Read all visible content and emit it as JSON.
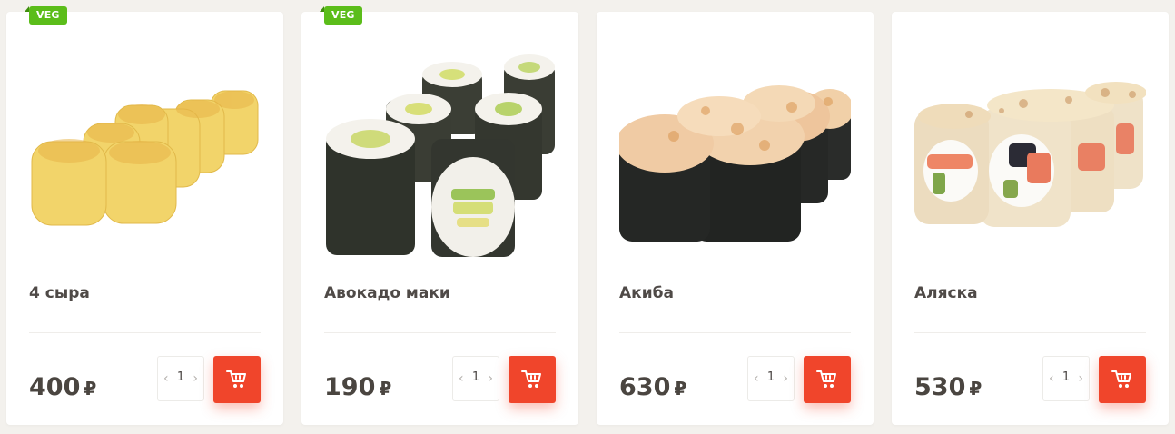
{
  "theme": {
    "accent": "#f0452b",
    "veg_badge": "#5bbd1a",
    "background": "#f3f1ed"
  },
  "products": [
    {
      "name": "4 сыра",
      "price": "400",
      "currency": "₽",
      "qty": "1",
      "badge": "VEG",
      "qty_dec": "‹",
      "qty_inc": "›",
      "image_icon": "cheese-roll-photo"
    },
    {
      "name": "Авокадо маки",
      "price": "190",
      "currency": "₽",
      "qty": "1",
      "badge": "VEG",
      "qty_dec": "‹",
      "qty_inc": "›",
      "image_icon": "avocado-maki-photo"
    },
    {
      "name": "Акиба",
      "price": "630",
      "currency": "₽",
      "qty": "1",
      "badge": "",
      "qty_dec": "‹",
      "qty_inc": "›",
      "image_icon": "baked-roll-photo"
    },
    {
      "name": "Аляска",
      "price": "530",
      "currency": "₽",
      "qty": "1",
      "badge": "",
      "qty_dec": "‹",
      "qty_inc": "›",
      "image_icon": "alaska-roll-photo"
    }
  ]
}
